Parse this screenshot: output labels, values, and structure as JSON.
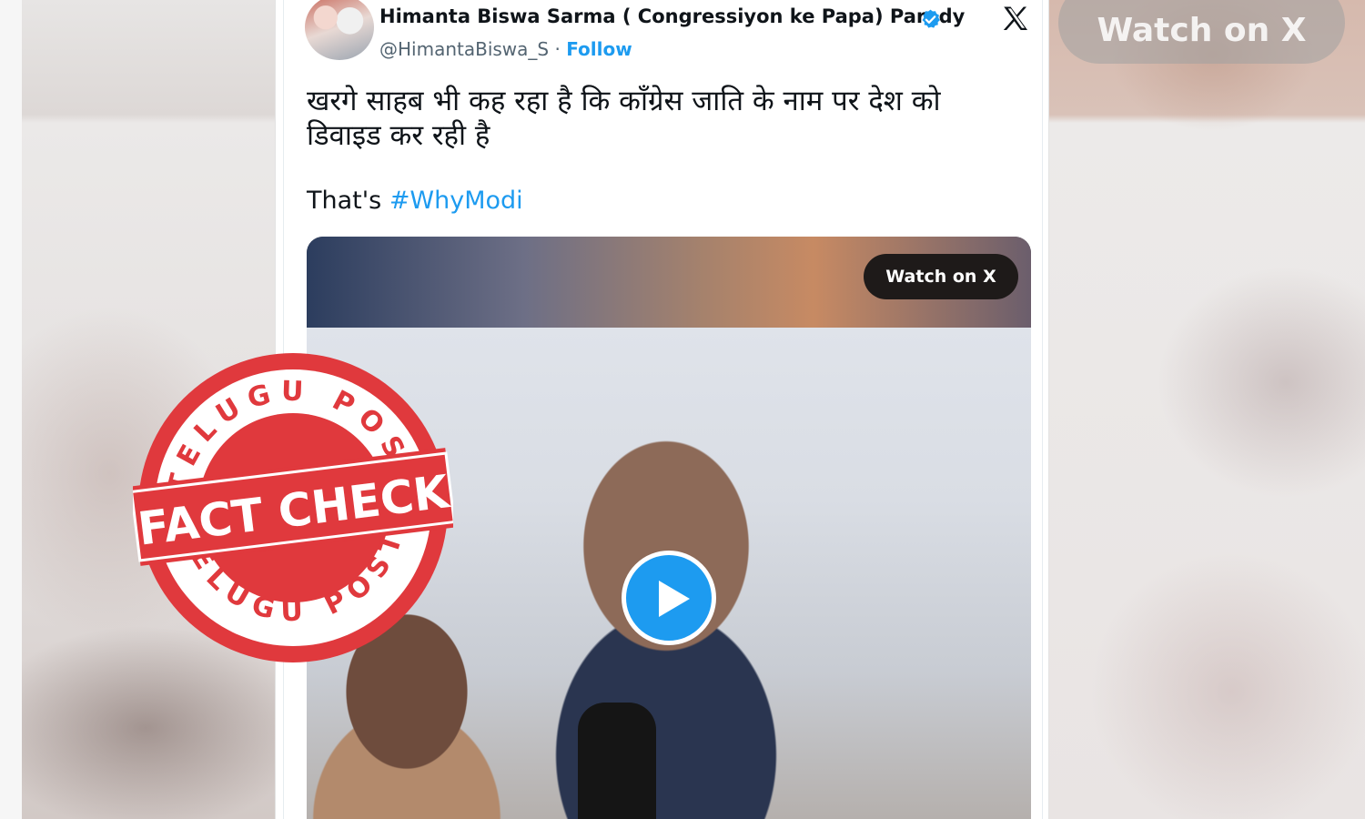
{
  "tweet": {
    "display_name": "Himanta Biswa Sarma ( Congressiyon ke Papa) Parody",
    "handle": "@HimantaBiswa_S",
    "separator": "·",
    "follow_label": "Follow",
    "text_line1": "खरगे साहब भी कह रहा है कि कॉंग्रेस जाति के नाम पर देश को",
    "text_line2": "डिवाइड कर रही है",
    "text_prefix": "That's ",
    "hashtag": "#WhyModi"
  },
  "video": {
    "watch_label": "Watch on X"
  },
  "background": {
    "watch_label": "Watch on X"
  },
  "stamp": {
    "top_text": "TELUGU POST",
    "main_text": "FACT CHECK",
    "bottom_text": "TELUGU POST",
    "color": "#e0393d"
  },
  "colors": {
    "accent": "#1d9bf0",
    "text": "#0f1419",
    "muted": "#536471"
  },
  "icons": {
    "verified": "verified-badge-icon",
    "x_logo": "x-logo-icon",
    "play": "play-icon"
  }
}
